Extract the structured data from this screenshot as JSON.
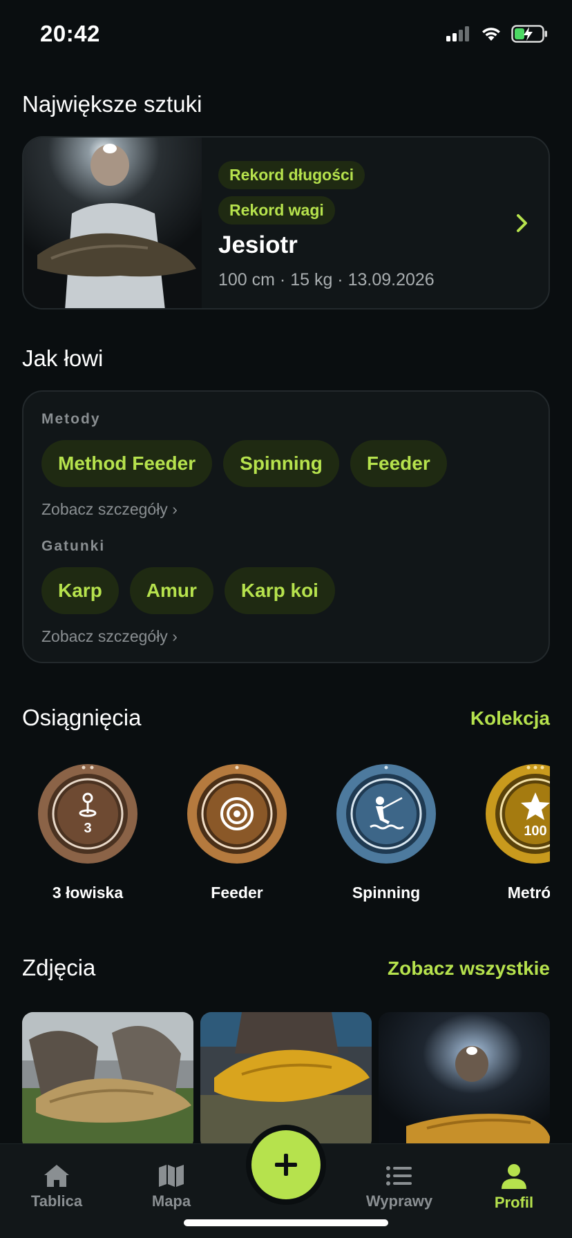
{
  "status": {
    "time": "20:42",
    "icons": [
      "signal-icon",
      "wifi-icon",
      "battery-charging-icon"
    ]
  },
  "biggest": {
    "title": "Największe sztuki",
    "chips": [
      "Rekord długości",
      "Rekord wagi"
    ],
    "species": "Jesiotr",
    "meta": "100 cm · 15 kg · 13.09.2026"
  },
  "fishing": {
    "title": "Jak łowi",
    "methods_label": "Metody",
    "methods": [
      "Method Feeder",
      "Spinning",
      "Feeder"
    ],
    "methods_link": "Zobacz szczegóły ›",
    "species_label": "Gatunki",
    "species": [
      "Karp",
      "Amur",
      "Karp koi"
    ],
    "species_link": "Zobacz szczegóły ›"
  },
  "achievements": {
    "title": "Osiągnięcia",
    "link": "Kolekcja",
    "badges": [
      {
        "label": "3 łowiska",
        "icon": "fishing-spot-icon",
        "number": "3",
        "color": "#8b6347"
      },
      {
        "label": "Feeder",
        "icon": "target-icon",
        "color": "#b57a3e"
      },
      {
        "label": "Spinning",
        "icon": "angler-icon",
        "color": "#4d7a9e"
      },
      {
        "label": "Metrów",
        "icon": "star-icon",
        "number": "100",
        "color": "#c99a1d"
      }
    ]
  },
  "photos": {
    "title": "Zdjęcia",
    "link": "Zobacz wszystkie"
  },
  "nav": {
    "items": [
      {
        "label": "Tablica",
        "icon": "home-icon"
      },
      {
        "label": "Mapa",
        "icon": "map-icon"
      },
      {
        "label": "Wyprawy",
        "icon": "list-icon"
      },
      {
        "label": "Profil",
        "icon": "profile-icon"
      }
    ],
    "fab_icon": "plus-icon"
  },
  "colors": {
    "accent": "#b6e24d",
    "background": "#0a0e10",
    "card": "#111618",
    "chip_bg": "#1f2a12"
  }
}
